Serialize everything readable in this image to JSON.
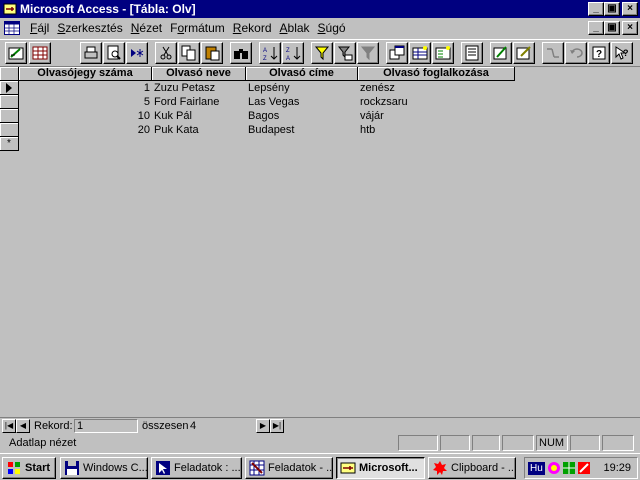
{
  "window": {
    "title": "Microsoft Access - [Tábla: Olv]"
  },
  "menu": [
    {
      "pre": "",
      "u": "F",
      "post": "ájl"
    },
    {
      "pre": "",
      "u": "S",
      "post": "zerkesztés"
    },
    {
      "pre": "",
      "u": "N",
      "post": "ézet"
    },
    {
      "pre": "F",
      "u": "o",
      "post": "rmátum"
    },
    {
      "pre": "",
      "u": "R",
      "post": "ekord"
    },
    {
      "pre": "",
      "u": "A",
      "post": "blak"
    },
    {
      "pre": "",
      "u": "S",
      "post": "úgó"
    }
  ],
  "columns": [
    "Olvasójegy száma",
    "Olvasó neve",
    "Olvasó címe",
    "Olvasó foglalkozása"
  ],
  "rows": [
    [
      "1",
      "Zuzu Petasz",
      "Lepsény",
      "zenész"
    ],
    [
      "5",
      "Ford Fairlane",
      "Las Vegas",
      "rockzsaru"
    ],
    [
      "10",
      "Kuk Pál",
      "Bagos",
      "vájár"
    ],
    [
      "20",
      "Puk Kata",
      "Budapest",
      "htb"
    ]
  ],
  "new_row_marker": "*",
  "nav": {
    "record_label": "Rekord:",
    "record_value": "1",
    "total_label": "összesen",
    "total_value": "4"
  },
  "status": {
    "text": "Adatlap nézet",
    "num": "NUM"
  },
  "taskbar": {
    "start": "Start",
    "tasks": [
      "Windows C...",
      "Feladatok : ...",
      "Feladatok - ...",
      "Microsoft...",
      "Clipboard - ..."
    ],
    "tray_lang": "Hu",
    "clock": "19:29"
  },
  "colors": {
    "title_bar": "#000080",
    "face": "#c0c0c0"
  }
}
